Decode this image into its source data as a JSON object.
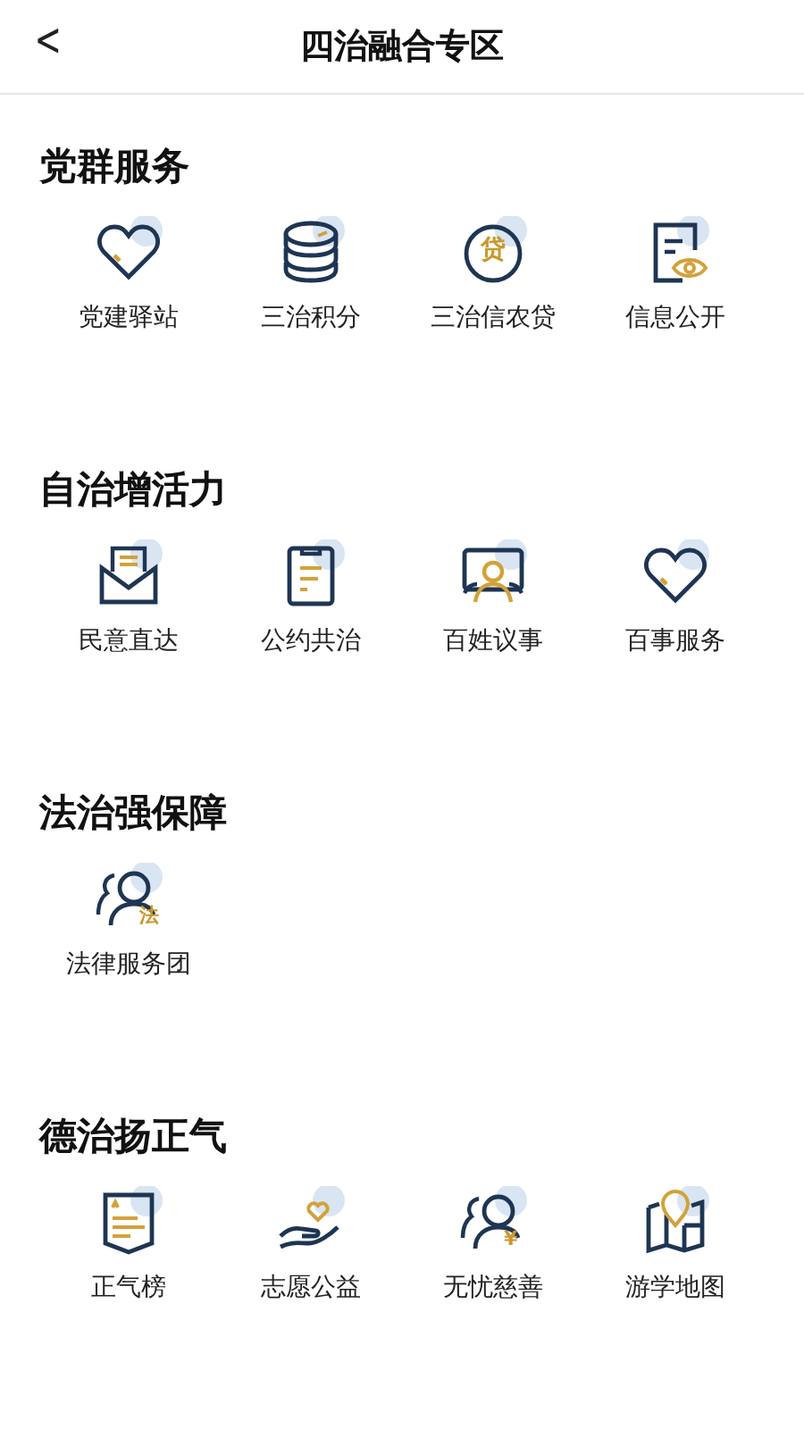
{
  "header": {
    "back": "<",
    "title": "四治融合专区"
  },
  "sections": [
    {
      "title": "党群服务",
      "items": [
        {
          "label": "党建驿站",
          "kind": "heart"
        },
        {
          "label": "三治积分",
          "kind": "coins"
        },
        {
          "label": "三治信农贷",
          "kind": "seal",
          "glyph": "贷"
        },
        {
          "label": "信息公开",
          "kind": "document"
        }
      ]
    },
    {
      "title": "自治增活力",
      "items": [
        {
          "label": "民意直达",
          "kind": "mail"
        },
        {
          "label": "公约共治",
          "kind": "clipboard"
        },
        {
          "label": "百姓议事",
          "kind": "meeting"
        },
        {
          "label": "百事服务",
          "kind": "heart"
        }
      ]
    },
    {
      "title": "法治强保障",
      "items": [
        {
          "label": "法律服务团",
          "kind": "people",
          "glyph": "法"
        }
      ]
    },
    {
      "title": "德治扬正气",
      "items": [
        {
          "label": "正气榜",
          "kind": "banner"
        },
        {
          "label": "志愿公益",
          "kind": "hand"
        },
        {
          "label": "无忧慈善",
          "kind": "people",
          "glyph": "¥"
        },
        {
          "label": "游学地图",
          "kind": "map"
        }
      ]
    }
  ]
}
